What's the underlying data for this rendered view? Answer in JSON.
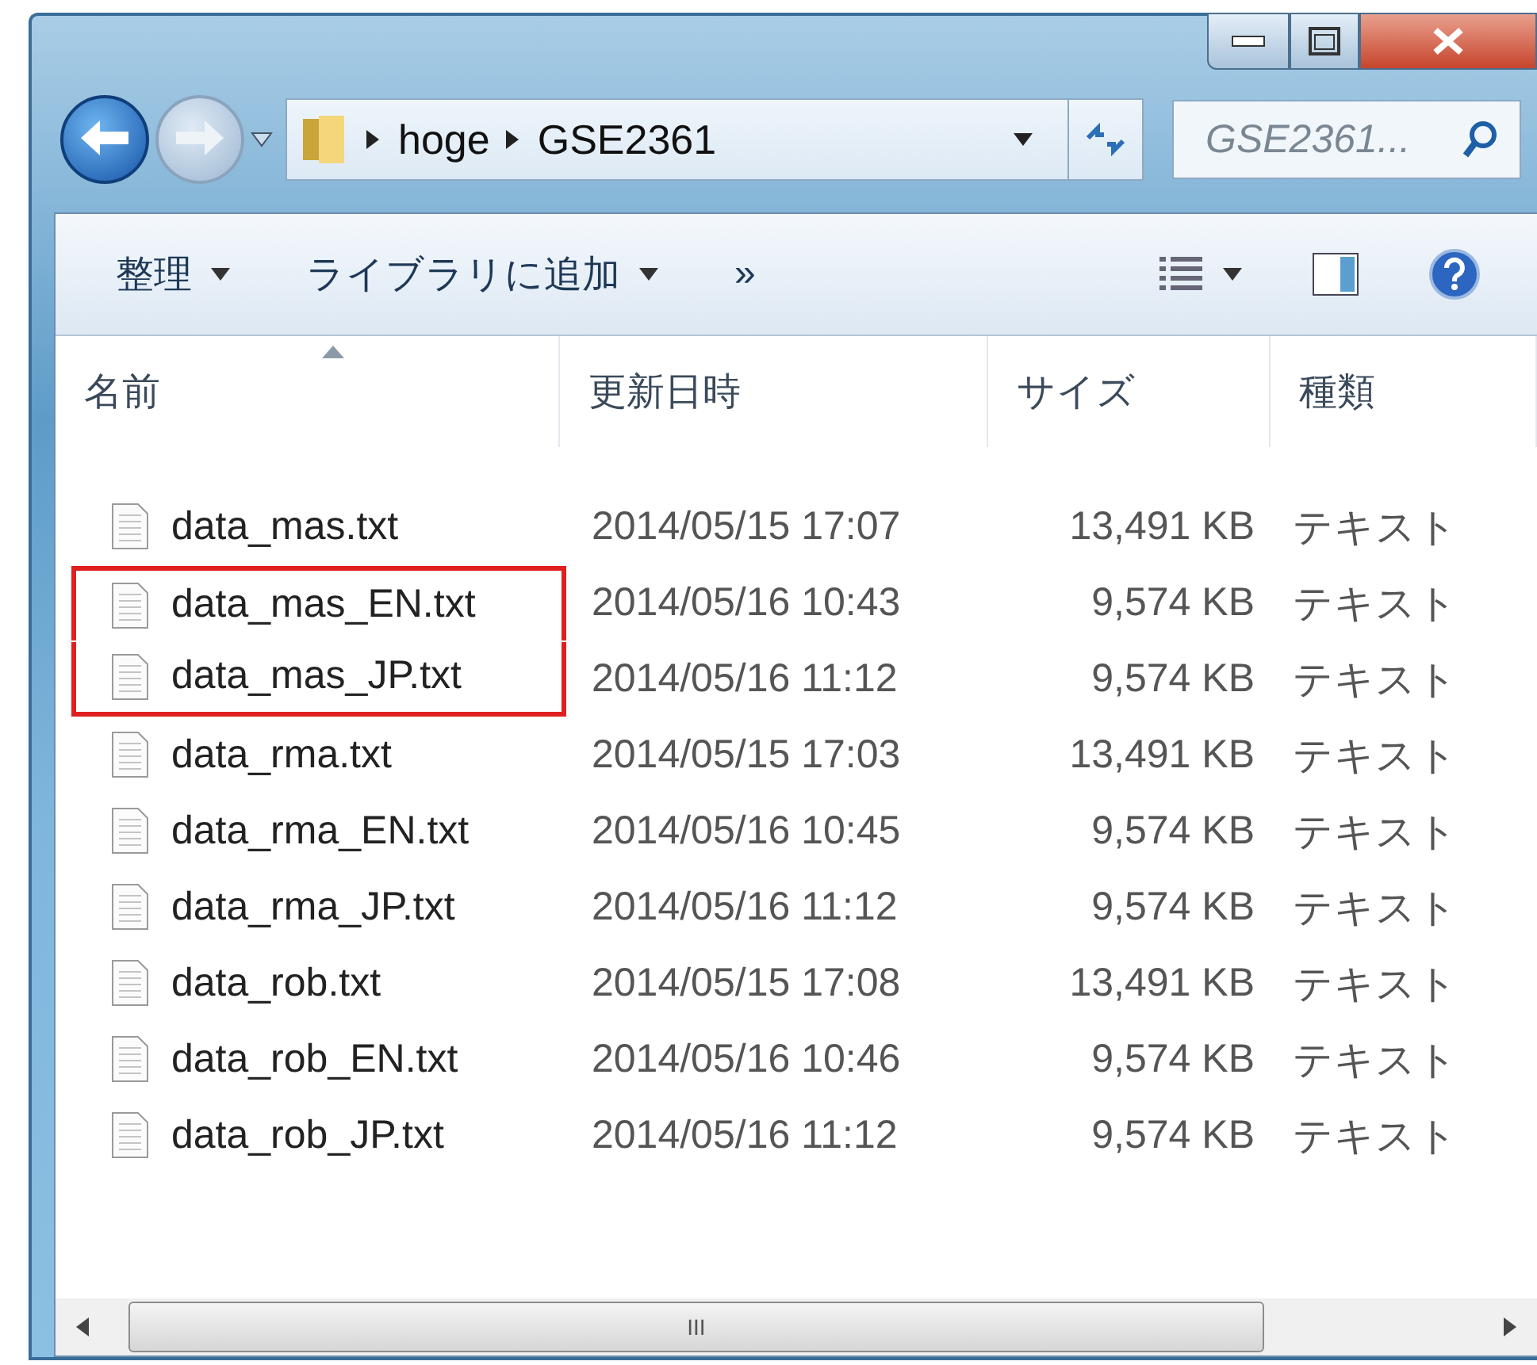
{
  "address_bar": {
    "breadcrumbs": [
      "hoge",
      "GSE2361"
    ]
  },
  "search": {
    "placeholder": "GSE2361..."
  },
  "toolbar": {
    "items": [
      {
        "label": "整理",
        "kind": "menu"
      },
      {
        "label": "ライブラリに追加",
        "kind": "menu"
      },
      {
        "label": "»",
        "kind": "more"
      }
    ]
  },
  "table": {
    "columns": [
      {
        "label": "名前",
        "sorted": true
      },
      {
        "label": "更新日時",
        "sorted": false
      },
      {
        "label": "サイズ",
        "sorted": false
      },
      {
        "label": "種類",
        "sorted": false
      }
    ],
    "rows": [
      {
        "name": "data_mas.txt",
        "modified": "2014/05/15 17:07",
        "size": "13,491 KB",
        "type": "テキスト",
        "marked": false
      },
      {
        "name": "data_mas_EN.txt",
        "modified": "2014/05/16 10:43",
        "size": "9,574 KB",
        "type": "テキスト",
        "marked": true
      },
      {
        "name": "data_mas_JP.txt",
        "modified": "2014/05/16 11:12",
        "size": "9,574 KB",
        "type": "テキスト",
        "marked": true
      },
      {
        "name": "data_rma.txt",
        "modified": "2014/05/15 17:03",
        "size": "13,491 KB",
        "type": "テキスト",
        "marked": false
      },
      {
        "name": "data_rma_EN.txt",
        "modified": "2014/05/16 10:45",
        "size": "9,574 KB",
        "type": "テキスト",
        "marked": false
      },
      {
        "name": "data_rma_JP.txt",
        "modified": "2014/05/16 11:12",
        "size": "9,574 KB",
        "type": "テキスト",
        "marked": false
      },
      {
        "name": "data_rob.txt",
        "modified": "2014/05/15 17:08",
        "size": "13,491 KB",
        "type": "テキスト",
        "marked": false
      },
      {
        "name": "data_rob_EN.txt",
        "modified": "2014/05/16 10:46",
        "size": "9,574 KB",
        "type": "テキスト",
        "marked": false
      },
      {
        "name": "data_rob_JP.txt",
        "modified": "2014/05/16 11:12",
        "size": "9,574 KB",
        "type": "テキスト",
        "marked": false
      }
    ]
  },
  "scrollbar": {
    "grip": "III"
  }
}
